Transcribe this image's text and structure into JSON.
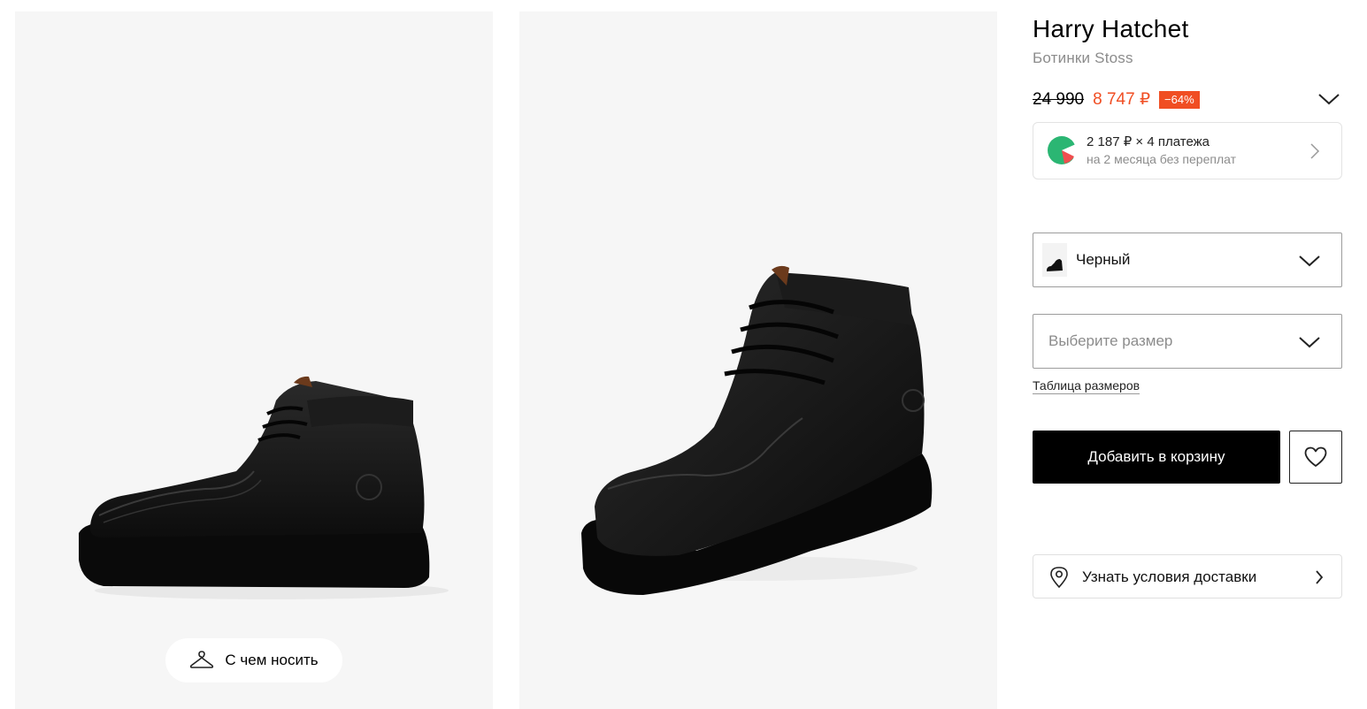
{
  "gallery": {
    "wear_button_label": "С чем носить"
  },
  "product": {
    "brand": "Harry Hatchet",
    "name": "Ботинки Stoss"
  },
  "price": {
    "old": "24 990",
    "current": "8 747 ₽",
    "discount": "−64%"
  },
  "installment": {
    "main": "2 187 ₽ × 4 платежа",
    "sub": "на 2 месяца без переплат"
  },
  "color_select": {
    "value": "Черный"
  },
  "size_select": {
    "placeholder": "Выберите размер"
  },
  "size_table_link": "Таблица размеров",
  "cart": {
    "add_label": "Добавить в корзину"
  },
  "delivery": {
    "label": "Узнать условия доставки"
  },
  "colors": {
    "accent": "#f04e23",
    "gallery_bg": "#f6f6f6",
    "button_bg": "#000000"
  },
  "icons": {
    "hanger": "hanger-icon",
    "chevron": "chevron-down-icon",
    "arrow": "chevron-right-icon",
    "heart": "heart-icon",
    "pin": "location-pin-icon",
    "installment_logo": "split-payment-logo"
  }
}
